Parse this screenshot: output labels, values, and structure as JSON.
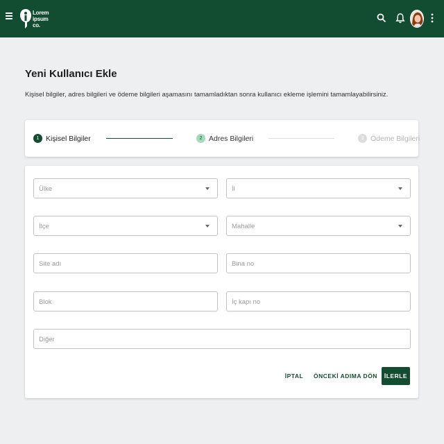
{
  "brand": {
    "logo_text_lines": [
      "Lorem",
      "ipsum",
      "co."
    ]
  },
  "colors": {
    "primary": "#124d31",
    "step_inactive": "#dcdcdc",
    "step_next": "#a6d9bd"
  },
  "icons": {
    "menu": "hamburger-icon",
    "search": "search-icon",
    "notifications": "bell-icon",
    "more": "more-vert-icon"
  },
  "page": {
    "title": "Yeni Kullanıcı Ekle",
    "description": "Kişisel bilgiler, adres bilgileri ve ödeme bilgileri aşamasını tamamladıktan sonra kullanıcı ekleme işlemini tamamlayabilirsiniz."
  },
  "stepper": {
    "steps": [
      {
        "number": "1",
        "label": "Kişisel Bilgiler",
        "state": "active"
      },
      {
        "number": "2",
        "label": "Adres Bilgileri",
        "state": "next"
      },
      {
        "number": "3",
        "label": "Ödeme Bilgileri",
        "state": "disabled"
      }
    ]
  },
  "form": {
    "country": {
      "placeholder": "Ülke",
      "value": ""
    },
    "city": {
      "placeholder": "İl",
      "value": ""
    },
    "district": {
      "placeholder": "İlçe",
      "value": ""
    },
    "neighborhood": {
      "placeholder": "Mahalle",
      "value": ""
    },
    "site_name": {
      "placeholder": "Site adı",
      "value": ""
    },
    "building_no": {
      "placeholder": "Bina no",
      "value": ""
    },
    "block": {
      "placeholder": "Blok",
      "value": ""
    },
    "door_no": {
      "placeholder": "İç kapı no",
      "value": ""
    },
    "other": {
      "placeholder": "Diğer",
      "value": ""
    }
  },
  "actions": {
    "cancel": "İPTAL",
    "back": "ÖNCEKİ ADIMA DÖN",
    "next": "İLERLE"
  }
}
